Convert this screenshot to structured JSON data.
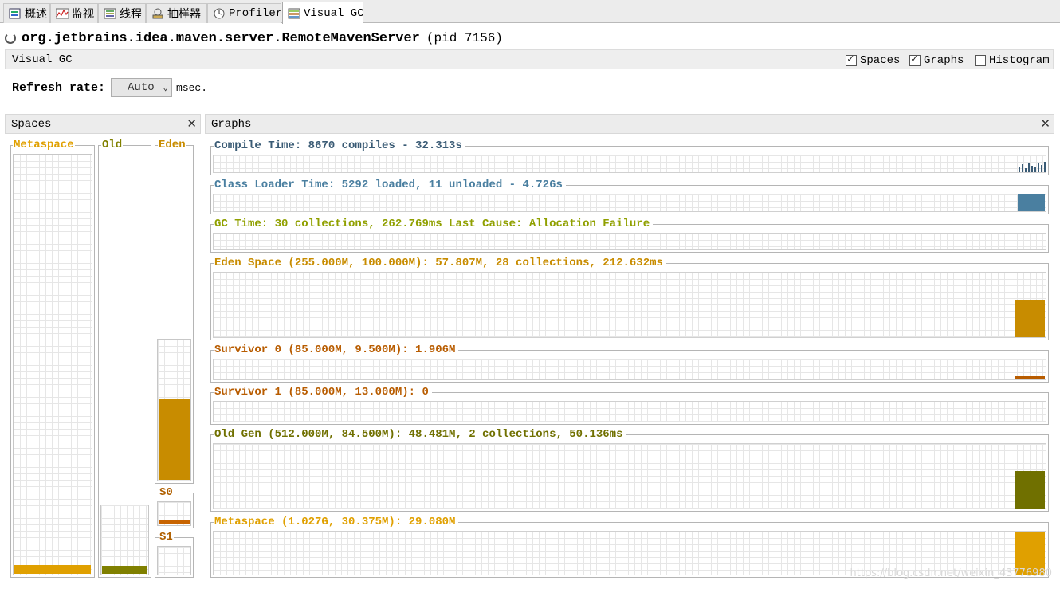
{
  "tabs": [
    {
      "label": "概述",
      "icon": "overview-icon"
    },
    {
      "label": "监视",
      "icon": "monitor-icon"
    },
    {
      "label": "线程",
      "icon": "threads-icon"
    },
    {
      "label": "抽样器",
      "icon": "sampler-icon"
    },
    {
      "label": "Profiler",
      "icon": "profiler-icon"
    },
    {
      "label": "Visual GC",
      "icon": "visual-gc-icon",
      "active": true
    }
  ],
  "app": {
    "name": "org.jetbrains.idea.maven.server.RemoteMavenServer",
    "pid": "(pid 7156)"
  },
  "header": {
    "title": "Visual GC",
    "spaces_label": "Spaces",
    "spaces_checked": true,
    "graphs_label": "Graphs",
    "graphs_checked": true,
    "histogram_label": "Histogram",
    "histogram_checked": false
  },
  "refresh": {
    "label": "Refresh rate:",
    "value": "Auto",
    "unit": "msec."
  },
  "spaces_panel": {
    "title": "Spaces",
    "metaspace": {
      "label": "Metaspace",
      "fill": 0.02,
      "color": "#e0a000"
    },
    "old": {
      "label": "Old",
      "fill": 0.11,
      "color": "#808000"
    },
    "eden": {
      "label": "Eden",
      "fill": 0.57,
      "color": "#c88c00"
    },
    "s0": {
      "label": "S0",
      "fill": 0.2,
      "color": "#c86400"
    },
    "s1": {
      "label": "S1",
      "fill": 0.0,
      "color": "#c86400"
    }
  },
  "graphs_panel": {
    "title": "Graphs",
    "graphs": [
      {
        "title": "Compile Time: 8670 compiles - 32.313s",
        "color": "#3a5b75"
      },
      {
        "title": "Class Loader Time: 5292 loaded, 11 unloaded - 4.726s",
        "color": "#4a7fa0"
      },
      {
        "title": "GC Time: 30 collections, 262.769ms Last Cause: Allocation Failure",
        "color": "#90a000"
      },
      {
        "title": "Eden Space (255.000M, 100.000M): 57.807M, 28 collections, 212.632ms",
        "color": "#c88c00"
      },
      {
        "title": "Survivor 0 (85.000M, 9.500M): 1.906M",
        "color": "#b85c00"
      },
      {
        "title": "Survivor 1 (85.000M, 13.000M): 0",
        "color": "#b85c00"
      },
      {
        "title": "Old Gen (512.000M, 84.500M): 48.481M, 2 collections, 50.136ms",
        "color": "#707000"
      },
      {
        "title": "Metaspace (1.027G, 30.375M): 29.080M",
        "color": "#e0a000"
      }
    ]
  },
  "watermark": "https://blog.csdn.net/weixin_43776980"
}
